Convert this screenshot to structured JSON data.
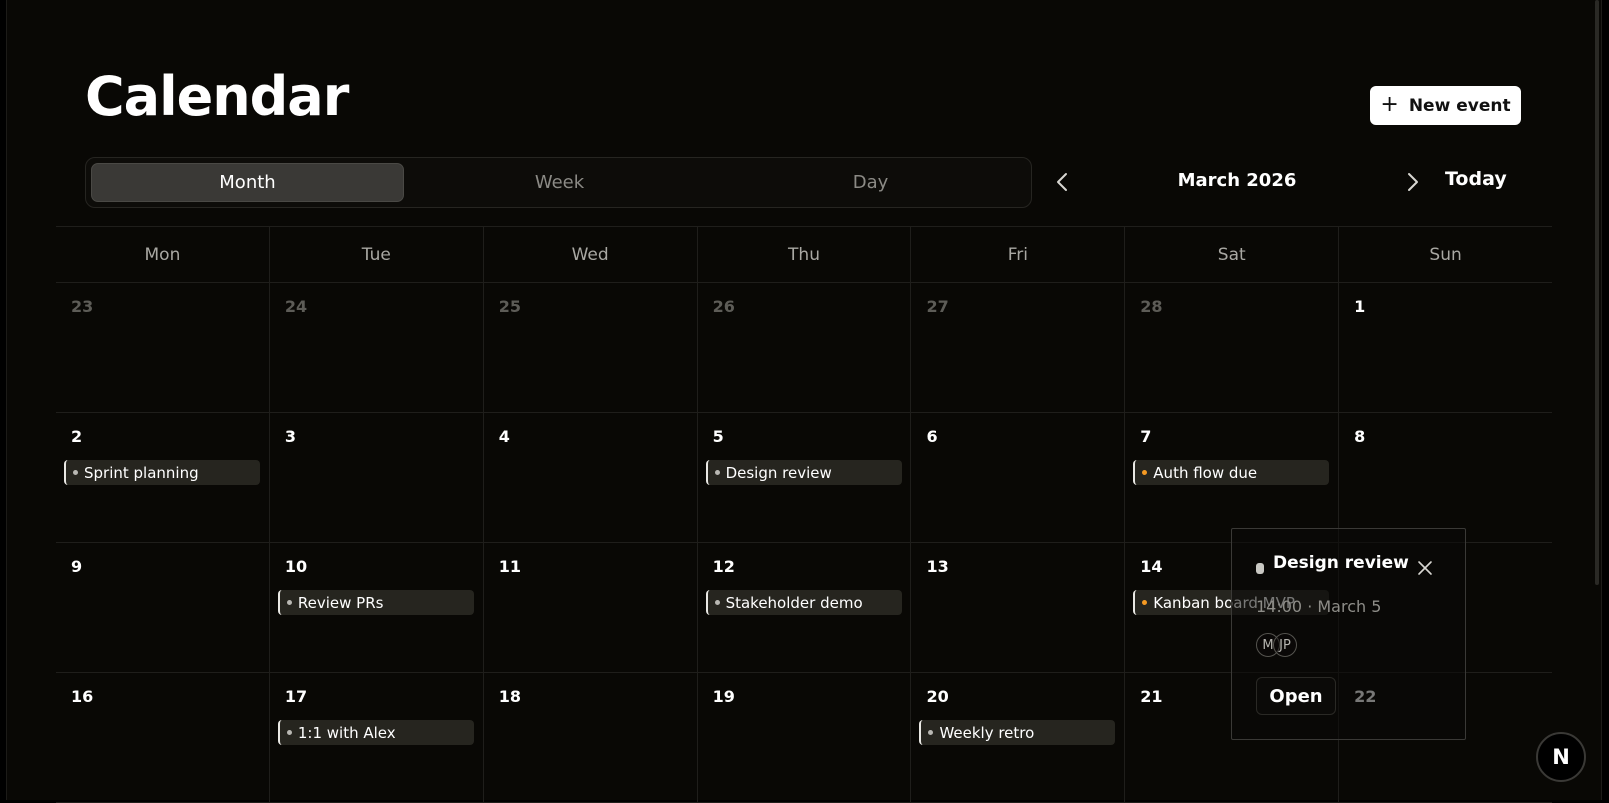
{
  "header": {
    "title": "Calendar",
    "new_event_label": "New event",
    "new_event_icon": "plus-icon"
  },
  "views": [
    {
      "label": "Month",
      "active": true
    },
    {
      "label": "Week",
      "active": false
    },
    {
      "label": "Day",
      "active": false
    }
  ],
  "nav": {
    "month_label": "March 2026",
    "today_label": "Today",
    "prev_icon": "chevron-left-icon",
    "next_icon": "chevron-right-icon"
  },
  "weekdays": [
    "Mon",
    "Tue",
    "Wed",
    "Thu",
    "Fri",
    "Sat",
    "Sun"
  ],
  "weeks": [
    [
      {
        "day": "23",
        "muted": true
      },
      {
        "day": "24",
        "muted": true
      },
      {
        "day": "25",
        "muted": true
      },
      {
        "day": "26",
        "muted": true
      },
      {
        "day": "27",
        "muted": true
      },
      {
        "day": "28",
        "muted": true
      },
      {
        "day": "1"
      }
    ],
    [
      {
        "day": "2",
        "event": {
          "title": "Sprint planning",
          "color": "#b9b8b3"
        }
      },
      {
        "day": "3"
      },
      {
        "day": "4"
      },
      {
        "day": "5",
        "event": {
          "title": "Design review",
          "color": "#b9b8b3"
        }
      },
      {
        "day": "6"
      },
      {
        "day": "7",
        "event": {
          "title": "Auth flow due",
          "color": "#f59a23"
        }
      },
      {
        "day": "8"
      }
    ],
    [
      {
        "day": "9"
      },
      {
        "day": "10",
        "event": {
          "title": "Review PRs",
          "color": "#b9b8b3"
        }
      },
      {
        "day": "11"
      },
      {
        "day": "12",
        "event": {
          "title": "Stakeholder demo",
          "color": "#b9b8b3"
        }
      },
      {
        "day": "13"
      },
      {
        "day": "14",
        "event": {
          "title": "Kanban board MVP",
          "color": "#f59a23"
        }
      },
      {
        "day": ""
      }
    ],
    [
      {
        "day": "16"
      },
      {
        "day": "17",
        "event": {
          "title": "1:1 with Alex",
          "color": "#b9b8b3"
        }
      },
      {
        "day": "18"
      },
      {
        "day": "19"
      },
      {
        "day": "20",
        "event": {
          "title": "Weekly retro",
          "color": "#b9b8b3"
        }
      },
      {
        "day": "21"
      },
      {
        "day": "22"
      }
    ]
  ],
  "popover": {
    "title": "Design review",
    "time": "14:00 · March 5",
    "attendees": [
      "M",
      "JP"
    ],
    "open_label": "Open",
    "close_icon": "close-icon"
  },
  "badge": {
    "label": "N"
  },
  "colors": {
    "background": "#090805",
    "accent_orange": "#f59a23",
    "chip": "#26251f"
  }
}
